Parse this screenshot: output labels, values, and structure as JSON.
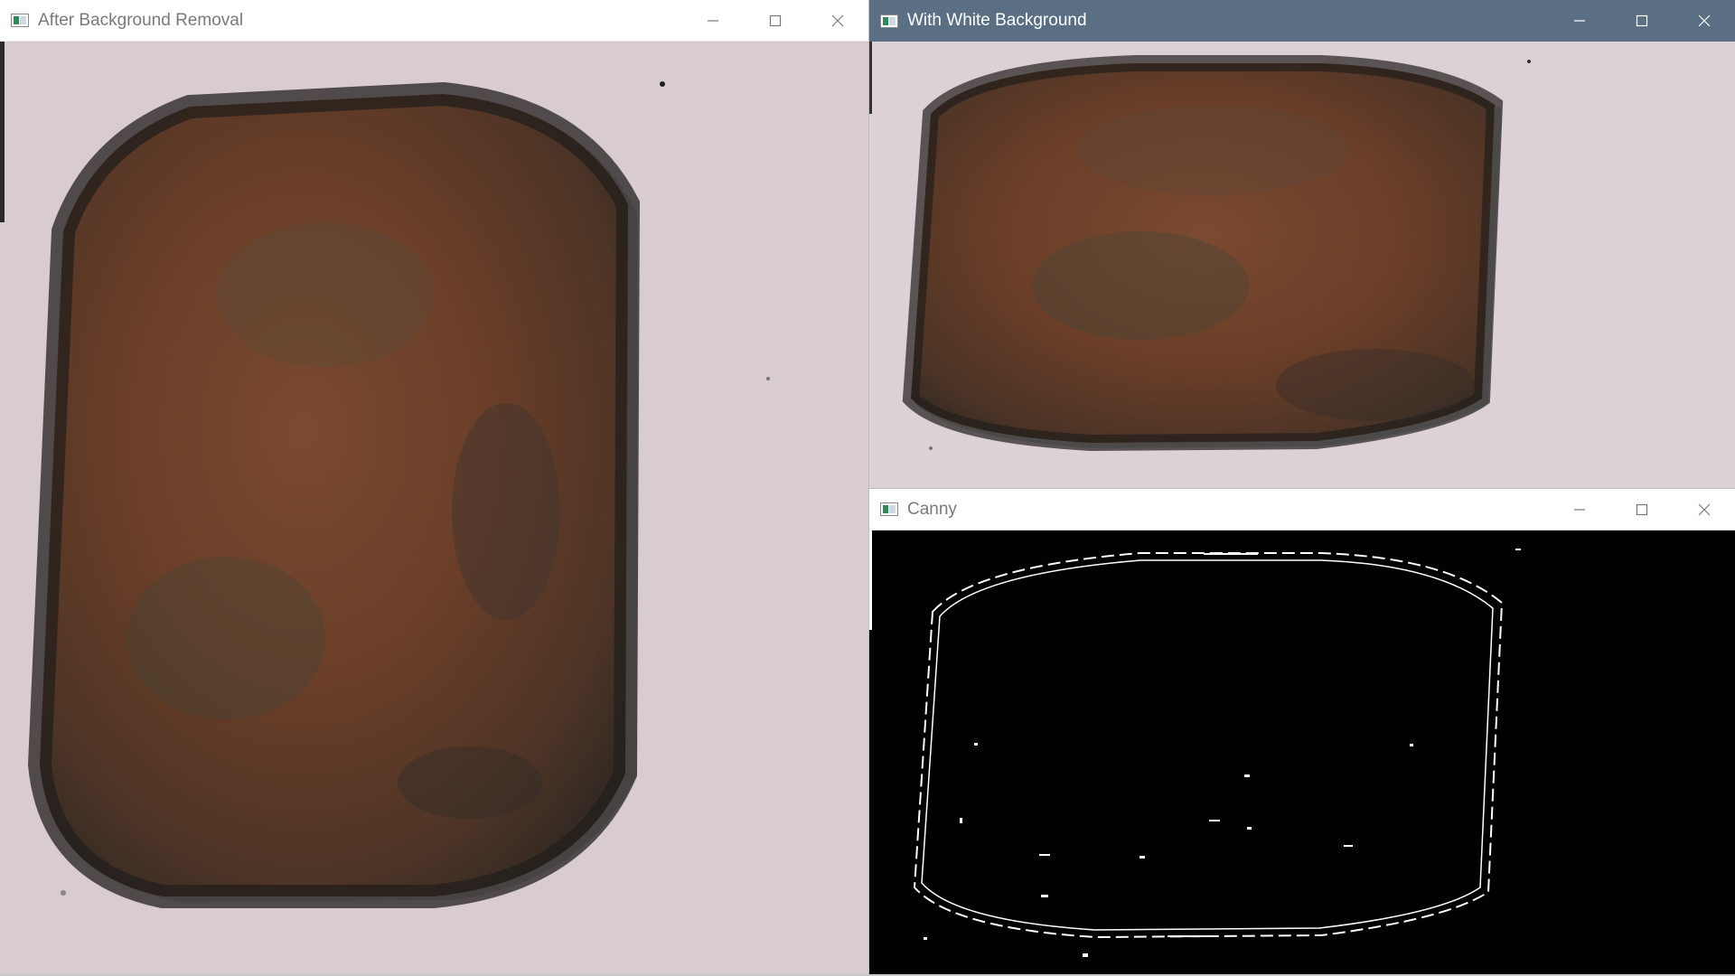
{
  "windows": {
    "left": {
      "title": "After Background Removal"
    },
    "right_top": {
      "title": "With White Background"
    },
    "right_bottom": {
      "title": "Canny"
    }
  },
  "icons": {
    "minimize": "minimize-icon",
    "maximize": "maximize-icon",
    "close": "close-icon",
    "app": "app-image-icon"
  },
  "colors": {
    "active_titlebar": "#5a6f84",
    "inactive_titlebar": "#ffffff",
    "paper_bg": "#d6c9cf",
    "rust_brown": "#6a3f2a",
    "edge_dark": "#2c2620",
    "canny_bg": "#000000",
    "canny_edge": "#ffffff"
  }
}
